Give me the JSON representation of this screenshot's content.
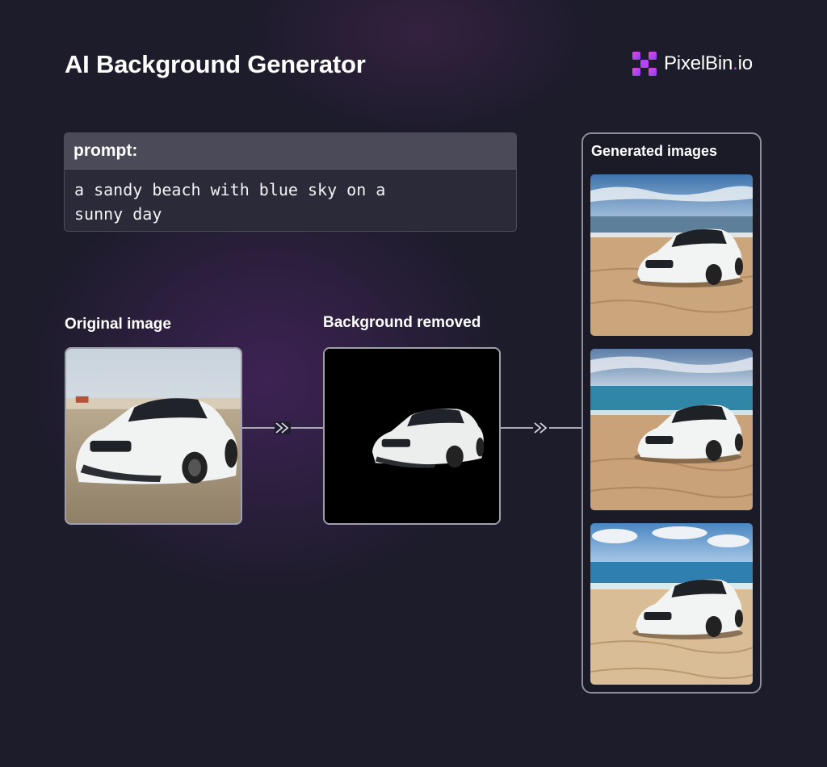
{
  "header": {
    "title": "AI Background Generator",
    "logo_text": "PixelBin",
    "logo_dot": ".",
    "logo_tld": "io",
    "logo_icon": "pixelbin-x-icon"
  },
  "prompt": {
    "label": "prompt:",
    "text": "a sandy beach with blue sky on a sunny day"
  },
  "stages": {
    "original_label": "Original image",
    "removed_label": "Background removed"
  },
  "generated": {
    "title": "Generated images",
    "count": 3
  },
  "colors": {
    "background": "#1d1c2b",
    "accent": "#c24bff",
    "panel_border": "#8d8d9c"
  }
}
